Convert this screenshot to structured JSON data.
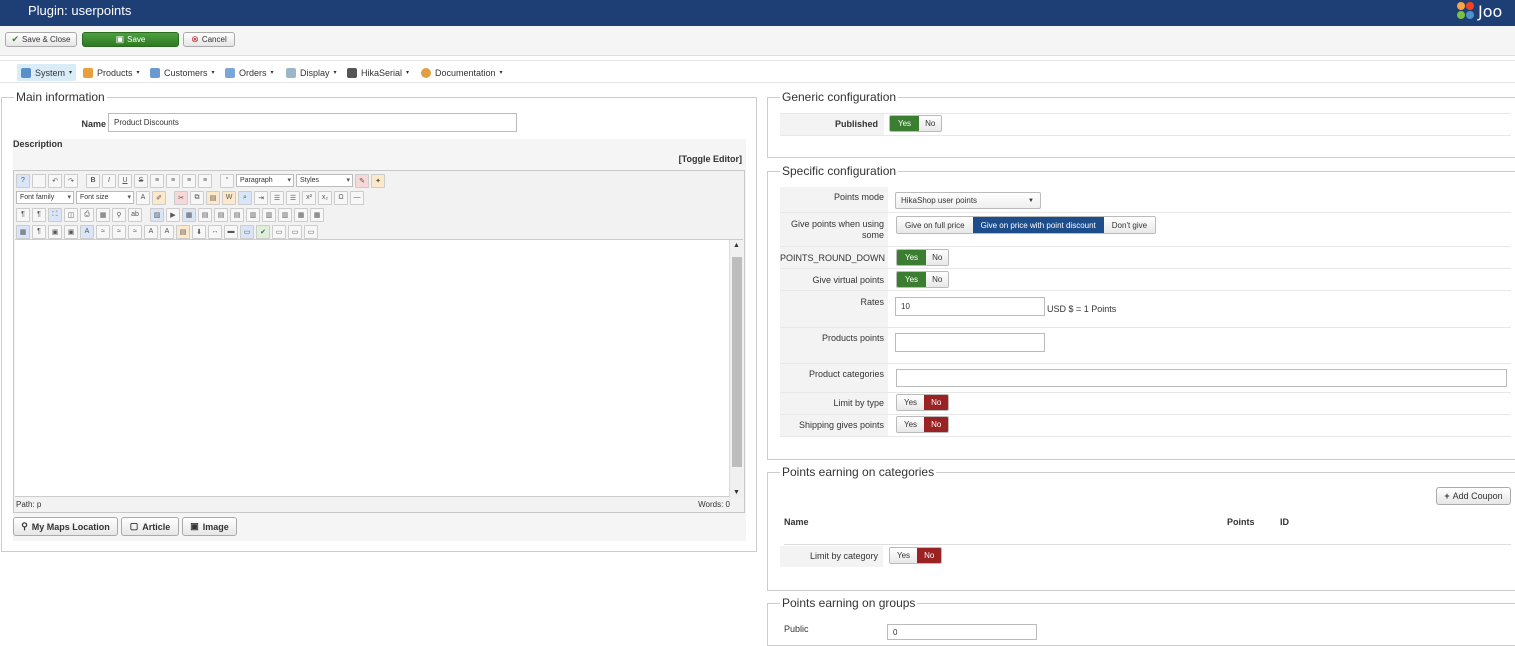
{
  "header": {
    "title": "Plugin: userpoints",
    "logo_text": "Joo"
  },
  "toolbar": {
    "save_close": "Save & Close",
    "save": "Save",
    "cancel": "Cancel"
  },
  "menu": [
    {
      "label": "System",
      "icon": "wrench-icon"
    },
    {
      "label": "Products",
      "icon": "box-icon"
    },
    {
      "label": "Customers",
      "icon": "users-icon"
    },
    {
      "label": "Orders",
      "icon": "orders-icon"
    },
    {
      "label": "Display",
      "icon": "display-icon"
    },
    {
      "label": "HikaSerial",
      "icon": "serial-icon"
    },
    {
      "label": "Documentation",
      "icon": "book-icon"
    }
  ],
  "main": {
    "legend": "Main information",
    "name_label": "Name",
    "name_value": "Product Discounts",
    "description_label": "Description",
    "toggle_editor": "[Toggle Editor]",
    "editor": {
      "format": "Paragraph",
      "styles": "Styles",
      "font_family": "Font family",
      "font_size": "Font size",
      "path": "Path:  p",
      "words": "Words: 0"
    },
    "buttons": {
      "maps": "My Maps Location",
      "article": "Article",
      "image": "Image"
    }
  },
  "generic": {
    "legend": "Generic configuration",
    "published_label": "Published",
    "yes": "Yes",
    "no": "No"
  },
  "specific": {
    "legend": "Specific configuration",
    "points_mode_label": "Points mode",
    "points_mode_value": "HikaShop user points",
    "give_points_label": "Give points when using some",
    "give_opts": [
      "Give on full price",
      "Give on price with point discount",
      "Don't give"
    ],
    "round_label": "POINTS_ROUND_DOWN",
    "virtual_label": "Give virtual points",
    "rates_label": "Rates",
    "rates_value": "10",
    "rates_unit": "USD $ = 1 Points",
    "products_points_label": "Products points",
    "product_categories_label": "Product categories",
    "limit_type_label": "Limit by type",
    "shipping_label": "Shipping gives points",
    "yes": "Yes",
    "no": "No"
  },
  "categories": {
    "legend": "Points earning on categories",
    "add_coupon": "Add Coupon",
    "col_name": "Name",
    "col_points": "Points",
    "col_id": "ID",
    "limit_label": "Limit by category",
    "yes": "Yes",
    "no": "No"
  },
  "groups": {
    "legend": "Points earning on groups",
    "public_label": "Public",
    "public_value": "0"
  }
}
